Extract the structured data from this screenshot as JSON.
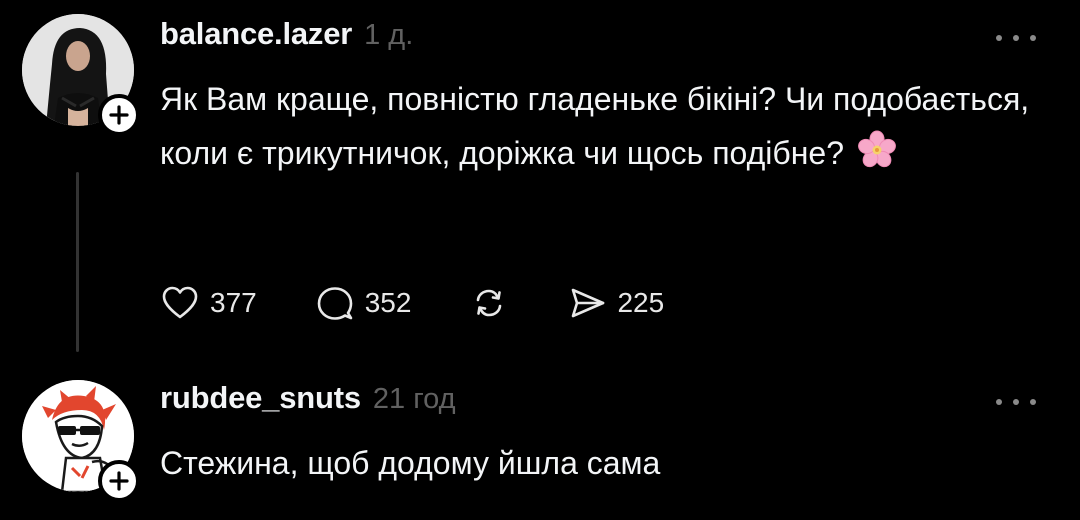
{
  "comments": [
    {
      "username": "balance.lazer",
      "time": "1 д.",
      "text": "Як Вам краще, повністю гладеньке бікіні? Чи подобається, коли є трикутничок, доріжка чи щось подібне?",
      "emoji": "cherry-blossom",
      "actions": {
        "likes": "377",
        "replies": "352",
        "shares": "225"
      }
    },
    {
      "username": "rubdee_snuts",
      "time": "21 год",
      "text": "Стежина, щоб додому йшла сама"
    }
  ],
  "colors": {
    "background": "#000000",
    "text": "#f3f5f7",
    "muted": "#616161",
    "thread_line": "#333333",
    "emoji_pink": "#f7a8c9"
  },
  "icons": [
    "heart-icon",
    "comment-icon",
    "repost-icon",
    "send-icon",
    "more-icon",
    "plus-icon"
  ]
}
